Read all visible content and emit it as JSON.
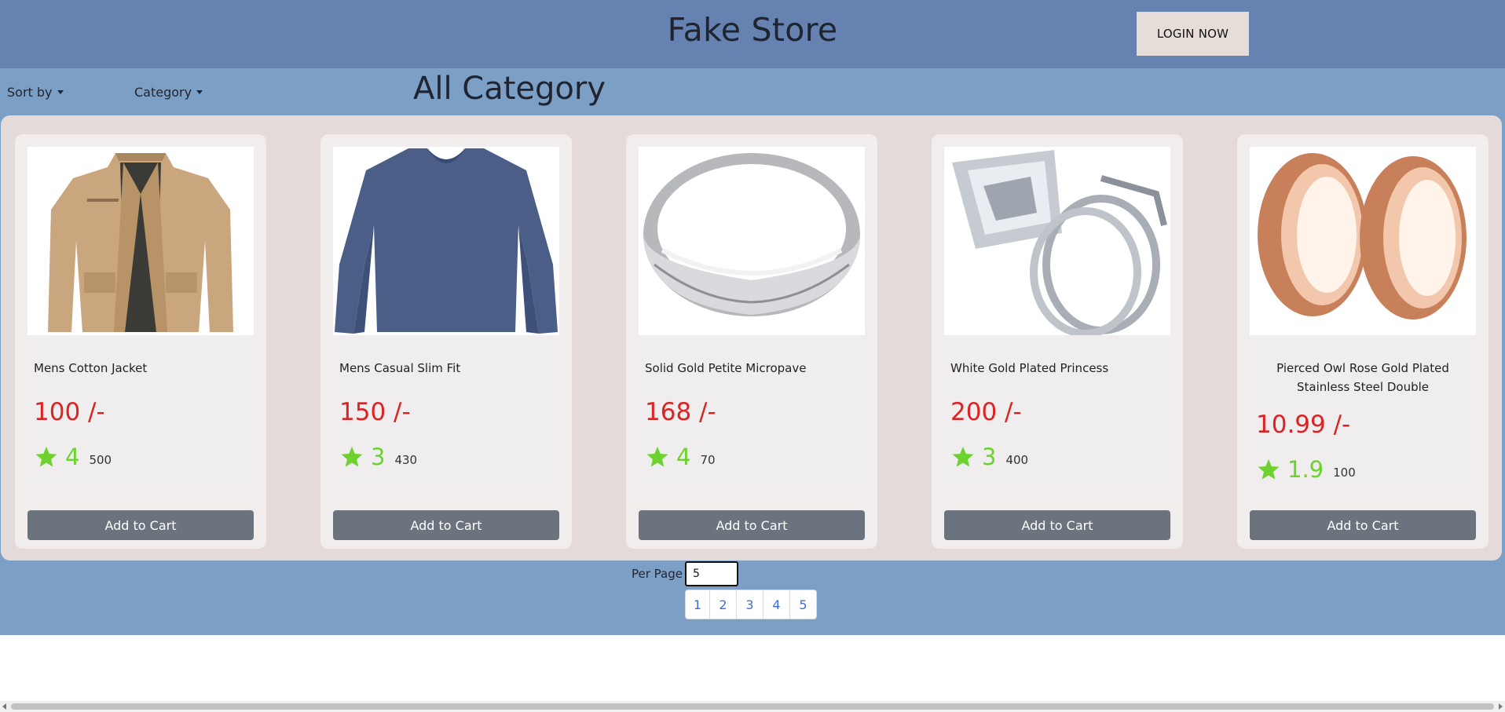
{
  "header": {
    "title": "Fake Store",
    "login_label": "LOGIN NOW"
  },
  "filters": {
    "sort_label": "Sort by",
    "category_label": "Category"
  },
  "page_heading": "All Category",
  "products": [
    {
      "name": "Mens Cotton Jacket",
      "price": "100 /-",
      "rating": "4",
      "count": "500",
      "button": "Add to Cart",
      "image_icon": "jacket-image"
    },
    {
      "name": "Mens Casual Slim Fit",
      "price": "150 /-",
      "rating": "3",
      "count": "430",
      "button": "Add to Cart",
      "image_icon": "shirt-image"
    },
    {
      "name": "Solid Gold Petite Micropave",
      "price": "168 /-",
      "rating": "4",
      "count": "70",
      "button": "Add to Cart",
      "image_icon": "ring-image"
    },
    {
      "name": "White Gold Plated Princess",
      "price": "200 /-",
      "rating": "3",
      "count": "400",
      "button": "Add to Cart",
      "image_icon": "diamond-ring-image"
    },
    {
      "name": "Pierced Owl Rose Gold Plated Stainless Steel Double",
      "price": "10.99 /-",
      "rating": "1.9",
      "count": "100",
      "button": "Add to Cart",
      "image_icon": "ear-plug-image"
    }
  ],
  "pagination": {
    "per_page_label": "Per Page",
    "per_page_value": "5",
    "pages": [
      "1",
      "2",
      "3",
      "4",
      "5"
    ]
  },
  "colors": {
    "header_bg": "#6582b0",
    "band_bg": "#7c9fc5",
    "price": "#dc2323",
    "star": "#6bd22e",
    "cart_button": "#6b747e"
  }
}
